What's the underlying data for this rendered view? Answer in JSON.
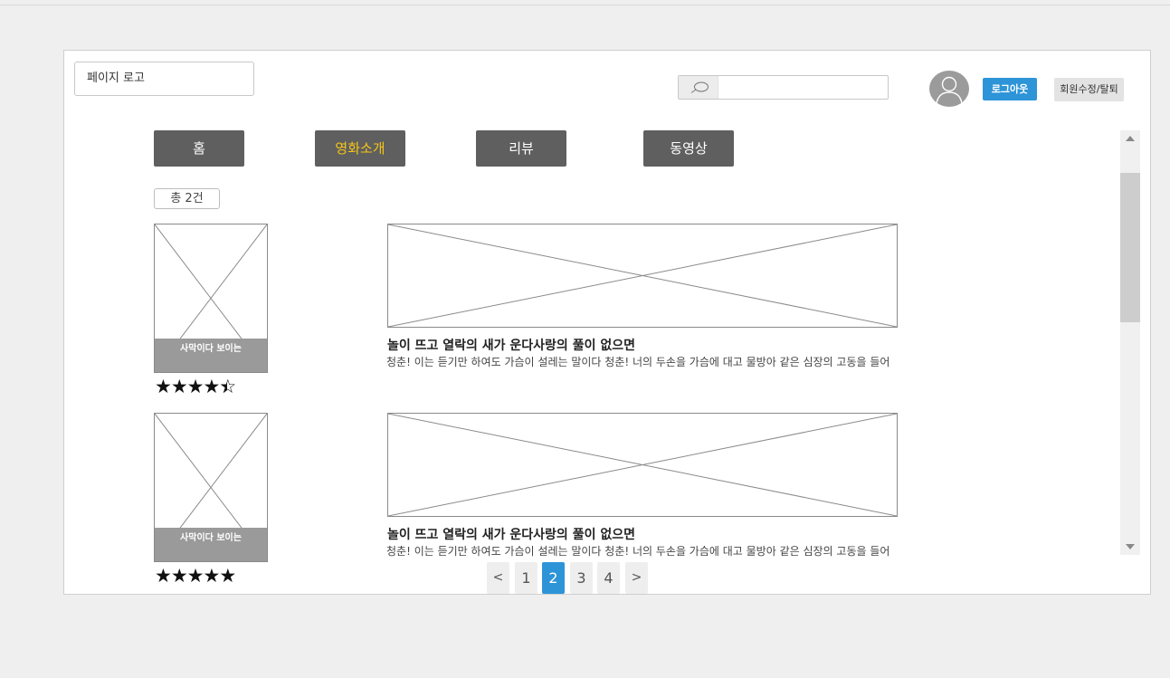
{
  "header": {
    "logo_text": "페이지 로고",
    "search_placeholder": "",
    "logout_label": "로그아웃",
    "edit_label": "회원수정/탈퇴"
  },
  "nav": {
    "items": [
      "홈",
      "영화소개",
      "리뷰",
      "동영상"
    ],
    "active_index": 1
  },
  "result_count": "총 2건",
  "reviews": [
    {
      "poster_caption": "사막이다 보이는",
      "rating": 4.5,
      "title": "놀이 뜨고 열락의 새가 운다사랑의 풀이 없으면",
      "text": "청춘! 이는 듣기만 하여도 가슴이 설레는 말이다 청춘! 너의 두손을 가슴에 대고 물방아 같은 심장의 고동을 들어"
    },
    {
      "poster_caption": "사막이다 보이는",
      "rating": 5,
      "title": "놀이 뜨고 열락의 새가 운다사랑의 풀이 없으면",
      "text": "청춘! 이는 듣기만 하여도 가슴이 설레는 말이다 청춘! 너의 두손을 가슴에 대고 물방아 같은 심장의 고동을 들어"
    }
  ],
  "pagination": {
    "prev": "<",
    "pages": [
      "1",
      "2",
      "3",
      "4"
    ],
    "current": "2",
    "next": ">"
  },
  "colors": {
    "accent": "#2e94d8",
    "nav_active_text": "#f5c518",
    "nav_bg": "#5f5f5f"
  },
  "icons": [
    "search-icon",
    "user-avatar-icon",
    "star-icon",
    "scroll-up-icon",
    "scroll-down-icon"
  ]
}
